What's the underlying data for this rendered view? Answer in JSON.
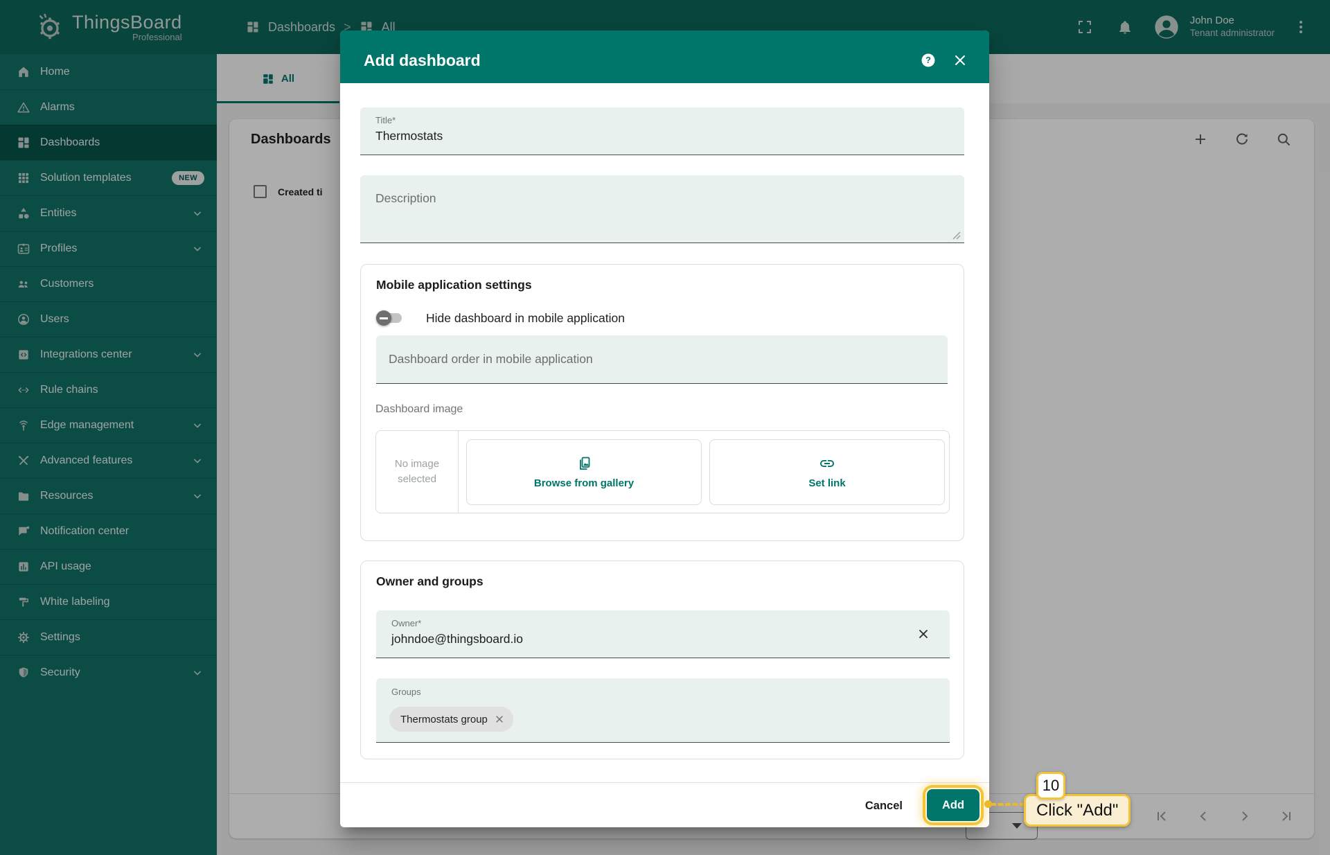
{
  "brand": {
    "name": "ThingsBoard",
    "edition": "Professional"
  },
  "topbar": {
    "breadcrumb": {
      "root": "Dashboards",
      "separator": ">",
      "current": "All"
    },
    "user": {
      "name": "John Doe",
      "role": "Tenant administrator"
    }
  },
  "sidebar": {
    "items": [
      {
        "label": "Home",
        "icon": "home-icon"
      },
      {
        "label": "Alarms",
        "icon": "warning-icon"
      },
      {
        "label": "Dashboards",
        "icon": "dashboards-icon",
        "selected": true
      },
      {
        "label": "Solution templates",
        "icon": "apps-icon",
        "badge": "NEW"
      },
      {
        "label": "Entities",
        "icon": "shapes-icon",
        "expandable": true
      },
      {
        "label": "Profiles",
        "icon": "id-badge-icon",
        "expandable": true
      },
      {
        "label": "Customers",
        "icon": "people-icon"
      },
      {
        "label": "Users",
        "icon": "person-icon"
      },
      {
        "label": "Integrations center",
        "icon": "integration-icon",
        "expandable": true
      },
      {
        "label": "Rule chains",
        "icon": "rule-chain-icon"
      },
      {
        "label": "Edge management",
        "icon": "antenna-icon",
        "expandable": true
      },
      {
        "label": "Advanced features",
        "icon": "tools-icon",
        "expandable": true
      },
      {
        "label": "Resources",
        "icon": "folder-icon",
        "expandable": true
      },
      {
        "label": "Notification center",
        "icon": "message-icon"
      },
      {
        "label": "API usage",
        "icon": "chart-icon"
      },
      {
        "label": "White labeling",
        "icon": "paint-icon"
      },
      {
        "label": "Settings",
        "icon": "gear-icon"
      },
      {
        "label": "Security",
        "icon": "shield-icon",
        "expandable": true
      }
    ]
  },
  "content": {
    "tab": "All",
    "page_title": "Dashboards",
    "table": {
      "column_created": "Created ti"
    }
  },
  "dialog": {
    "title": "Add dashboard",
    "help_glyph": "?",
    "fields": {
      "title_label": "Title*",
      "title_value": "Thermostats",
      "description_label": "Description"
    },
    "mobile_section": {
      "title": "Mobile application settings",
      "hide_toggle_label": "Hide dashboard in mobile application",
      "order_placeholder": "Dashboard order in mobile application",
      "image_label": "Dashboard image",
      "no_image": "No image selected",
      "browse_button": "Browse from gallery",
      "set_link_button": "Set link"
    },
    "owner_section": {
      "title": "Owner and groups",
      "owner_label": "Owner*",
      "owner_value": "johndoe@thingsboard.io",
      "groups_label": "Groups",
      "group_chip": "Thermostats group"
    },
    "footer": {
      "cancel": "Cancel",
      "add": "Add"
    }
  },
  "annotation": {
    "step": "10",
    "label": "Click \"Add\""
  },
  "colors": {
    "accent": "#00756A",
    "topbar": "#0D665B",
    "sidebar": "#117266",
    "field_bg": "#E9F1EF",
    "annotation_gold": "#F3C338"
  }
}
